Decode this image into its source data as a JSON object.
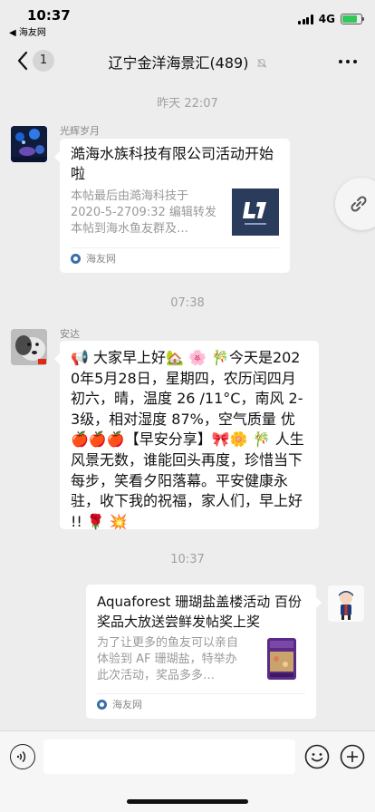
{
  "status_bar": {
    "time": "10:37",
    "back_app": "◀ 海友网",
    "network": "4G"
  },
  "nav": {
    "badge": "1",
    "title": "辽宁金洋海景汇(489)",
    "mute_icon": "bell-slash-icon"
  },
  "messages": [
    {
      "type": "time",
      "text": "昨天 22:07"
    },
    {
      "type": "card",
      "sender": "光辉岁月",
      "title": "澔海水族科技有限公司活动开始啦",
      "desc": "本帖最后由澔海科技于 2020-5-2709:32 编辑转发本帖到海水鱼友群及…",
      "source": "海友网",
      "thumb_caption": "澔海"
    },
    {
      "type": "time",
      "text": "07:38"
    },
    {
      "type": "text",
      "sender": "安达",
      "text": "📢 大家早上好🏡 🌸 🎋今天是2020年5月28日，星期四，农历闰四月初六，晴，温度 26 /11°C，南风 2-3级，相对湿度 87%，空气质量 优🍎🍎🍎【早安分享】🎀🌼 🎋 人生风景无数，谁能回头再度，珍惜当下每步，笑看夕阳落幕。平安健康永驻，收下我的祝福，家人们，早上好 !! 🌹 💥"
    },
    {
      "type": "time",
      "text": "10:37"
    },
    {
      "type": "card",
      "sender": "",
      "title": "Aquaforest 珊瑚盐盖楼活动 百份奖品大放送尝鲜发帖奖上奖",
      "desc": "为了让更多的鱼友可以亲自体验到 AF 珊瑚盐，特举办此次活动，奖品多多…",
      "source": "海友网"
    }
  ],
  "colors": {
    "background": "#ededed",
    "bubble": "#ffffff",
    "battery": "#34c759",
    "source_icon": "#3a6fa8"
  }
}
